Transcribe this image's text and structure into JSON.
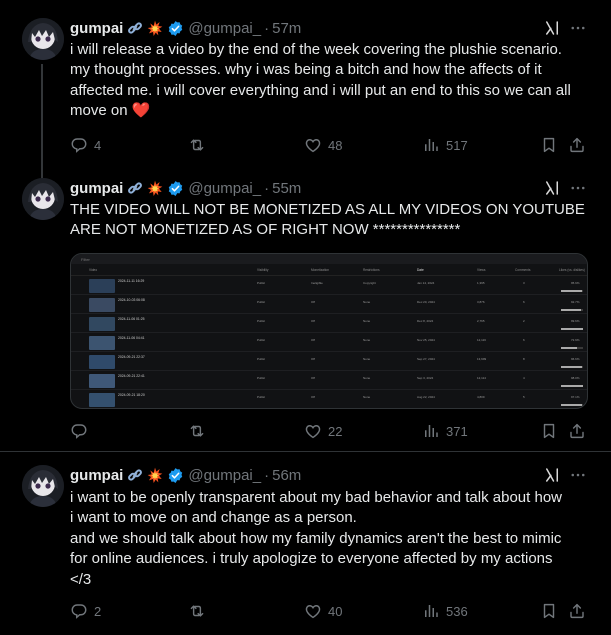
{
  "tweets": [
    {
      "name": "gumpai",
      "handle": "@gumpai_",
      "separator": "·",
      "time": "57m",
      "text": "i will release a video by the end of the week covering the plushie scenario.\nmy thought processes. why i was being a bitch and how the affects of it\naffected me. i will cover everything and i will put an end to this so we can all\nmove on ❤️",
      "replies": "4",
      "reposts": "",
      "likes": "48",
      "views": "517"
    },
    {
      "name": "gumpai",
      "handle": "@gumpai_",
      "separator": "·",
      "time": "55m",
      "text": "THE VIDEO WILL NOT BE MONETIZED AS ALL MY VIDEOS ON YOUTUBE\nARE NOT MONETIZED AS OF RIGHT NOW ***************",
      "replies": "",
      "reposts": "",
      "likes": "22",
      "views": "371"
    },
    {
      "name": "gumpai",
      "handle": "@gumpai_",
      "separator": "·",
      "time": "56m",
      "text": "i want to be openly transparent about my bad behavior and talk about how\ni want to move on and change as a person.\nand we should talk about how my family dynamics aren't the best to mimic\nfor online audiences. i truly apologize to everyone affected by my actions\n</3",
      "replies": "2",
      "reposts": "",
      "likes": "40",
      "views": "536"
    }
  ],
  "icons": {
    "emoji_1": "link-icon",
    "emoji_2": "collision-icon",
    "verified": "verified-badge-icon",
    "grok": "grok-icon",
    "more": "more-icon",
    "reply": "reply-icon",
    "repost": "repost-icon",
    "like": "like-icon",
    "views": "views-icon",
    "bookmark": "bookmark-icon",
    "share": "share-icon"
  },
  "colors": {
    "background": "#000000",
    "text": "#e7e9ea",
    "muted": "#71767b",
    "verified": "#1d9bf0",
    "divider": "#2f3336"
  },
  "media": {
    "filter_label": "Filter",
    "headers": [
      "Video",
      "Visibility",
      "Monetization",
      "Restrictions",
      "Date",
      "Views",
      "Comments",
      "Likes (vs. dislikes)"
    ],
    "rows": [
      {
        "title": "2024-11-11 16:29",
        "visibility": "Public",
        "monetization": "Ineligible",
        "restriction": "Copyright",
        "date": "Jan 14, 2024",
        "views": "1,395",
        "comments": "3",
        "likes": "95.9%",
        "like_ratio": 0.96,
        "thumb": "#2b3f58"
      },
      {
        "title": "2024-10-03 06:08",
        "visibility": "Public",
        "monetization": "Off",
        "restriction": "None",
        "date": "Dec 20, 2024",
        "views": "3,876",
        "comments": "6",
        "likes": "92.7%",
        "like_ratio": 0.93,
        "thumb": "#3a4a62"
      },
      {
        "title": "2024-11-06 01:25",
        "visibility": "Public",
        "monetization": "Off",
        "restriction": "None",
        "date": "Dec 8, 2024",
        "views": "2,765",
        "comments": "2",
        "likes": "99.6%",
        "like_ratio": 1.0,
        "thumb": "#314860"
      },
      {
        "title": "2024-11-06 04:41",
        "visibility": "Public",
        "monetization": "Off",
        "restriction": "None",
        "date": "Nov 25, 2024",
        "views": "12,116",
        "comments": "6",
        "likes": "72.9%",
        "like_ratio": 0.73,
        "thumb": "#3c5470"
      },
      {
        "title": "2024-09-21 22:37",
        "visibility": "Public",
        "monetization": "Off",
        "restriction": "None",
        "date": "Sep 27, 2024",
        "views": "13,999",
        "comments": "8",
        "likes": "96.6%",
        "like_ratio": 0.97,
        "thumb": "#2f4a6a"
      },
      {
        "title": "2024-09-21 22:41",
        "visibility": "Public",
        "monetization": "Off",
        "restriction": "None",
        "date": "Sep 3, 2024",
        "views": "12,114",
        "comments": "4",
        "likes": "98.0%",
        "like_ratio": 0.98,
        "thumb": "#3f5878"
      },
      {
        "title": "2024-09-21 18:20",
        "visibility": "Public",
        "monetization": "Off",
        "restriction": "None",
        "date": "Aug 22, 2024",
        "views": "4,809",
        "comments": "5",
        "likes": "97.1%",
        "like_ratio": 0.97,
        "thumb": "#34506e"
      }
    ]
  }
}
